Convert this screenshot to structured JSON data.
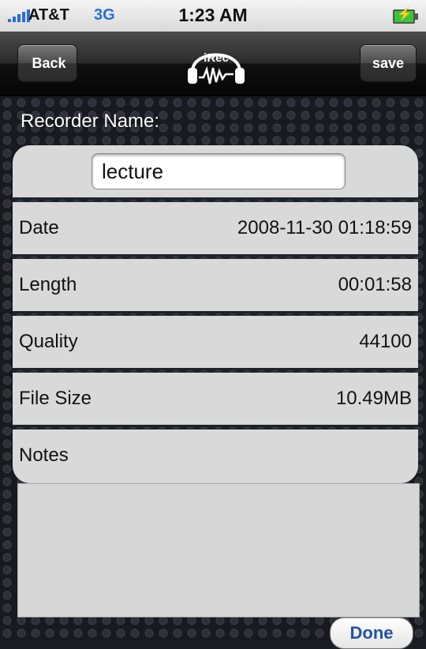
{
  "status": {
    "carrier": "AT&T",
    "network": "3G",
    "time": "1:23 AM",
    "battery_icon": "battery-charging-icon"
  },
  "navbar": {
    "back_label": "Back",
    "logo_text": "iRec",
    "save_label": "save"
  },
  "form": {
    "name_label": "Recorder Name:",
    "name_value": "lecture"
  },
  "details": [
    {
      "label": "Date",
      "value": "2008-11-30 01:18:59"
    },
    {
      "label": "Length",
      "value": "00:01:58"
    },
    {
      "label": "Quality",
      "value": "44100"
    },
    {
      "label": "File Size",
      "value": "10.49MB"
    },
    {
      "label": "Notes",
      "value": ""
    }
  ],
  "notes_text": "",
  "done_label": "Done",
  "colors": {
    "accent": "#2451a6",
    "signal": "#2a6ed6",
    "battery": "#38c638"
  }
}
